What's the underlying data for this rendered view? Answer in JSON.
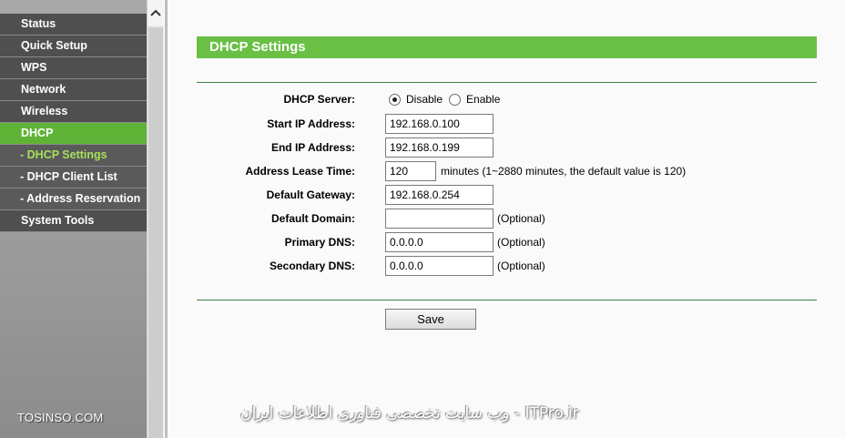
{
  "sidebar": {
    "items": [
      {
        "label": "Status"
      },
      {
        "label": "Quick Setup"
      },
      {
        "label": "WPS"
      },
      {
        "label": "Network"
      },
      {
        "label": "Wireless"
      },
      {
        "label": "DHCP"
      },
      {
        "label": "- DHCP Settings"
      },
      {
        "label": "- DHCP Client List"
      },
      {
        "label": "- Address Reservation"
      },
      {
        "label": "System Tools"
      }
    ],
    "watermark": "TOSINSO.COM"
  },
  "page": {
    "title": "DHCP Settings",
    "dhcp_server": {
      "label": "DHCP Server:",
      "options": [
        "Disable",
        "Enable"
      ],
      "selected": "Disable"
    },
    "start_ip": {
      "label": "Start IP Address:",
      "value": "192.168.0.100"
    },
    "end_ip": {
      "label": "End IP Address:",
      "value": "192.168.0.199"
    },
    "lease_time": {
      "label": "Address Lease Time:",
      "value": "120",
      "note": "minutes (1~2880 minutes, the default value is 120)"
    },
    "gateway": {
      "label": "Default Gateway:",
      "value": "192.168.0.254"
    },
    "domain": {
      "label": "Default Domain:",
      "value": "",
      "note": "(Optional)"
    },
    "primary_dns": {
      "label": "Primary DNS:",
      "value": "0.0.0.0",
      "note": "(Optional)"
    },
    "secondary_dns": {
      "label": "Secondary DNS:",
      "value": "0.0.0.0",
      "note": "(Optional)"
    },
    "save_label": "Save"
  },
  "watermark_right": "ITPro.ir - وب سایت تخصصی فناوری اطلاعات ایران",
  "colors": {
    "accent_green": "#6abf45",
    "menu_dark": "#4f4f4f",
    "active_green": "#5fb336",
    "sub_current": "#a5e05a"
  }
}
